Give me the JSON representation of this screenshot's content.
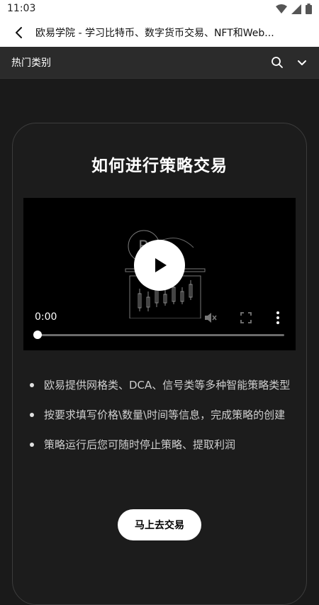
{
  "status_bar": {
    "time": "11:03"
  },
  "app_bar": {
    "title": "欧易学院 - 学习比特币、数字货币交易、NFT和Web..."
  },
  "category_bar": {
    "label": "热门类别"
  },
  "card": {
    "title": "如何进行策略交易",
    "video": {
      "current_time": "0:00",
      "progress": 0.0
    },
    "bullets": [
      "欧易提供网格类、DCA、信号类等多种智能策略类型",
      "按要求填写价格\\数量\\时间等信息，完成策略的创建",
      "策略运行后您可随时停止策略、提取利润"
    ],
    "cta_label": "马上去交易"
  },
  "icons": [
    "wifi-icon",
    "signal-icon",
    "battery-icon",
    "back-arrow-icon",
    "search-icon",
    "chevron-down-icon",
    "play-icon",
    "mute-icon",
    "fullscreen-icon",
    "more-vert-icon"
  ]
}
